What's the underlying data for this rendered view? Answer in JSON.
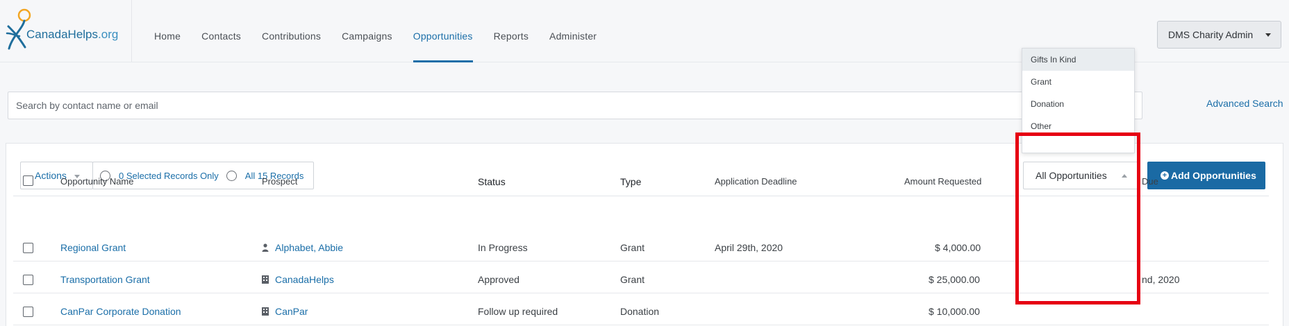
{
  "app": {
    "logo_name": "CanadaHelps",
    "logo_suffix": ".org"
  },
  "nav": {
    "items": [
      {
        "label": "Home",
        "active": false
      },
      {
        "label": "Contacts",
        "active": false
      },
      {
        "label": "Contributions",
        "active": false
      },
      {
        "label": "Campaigns",
        "active": false
      },
      {
        "label": "Opportunities",
        "active": true
      },
      {
        "label": "Reports",
        "active": false
      },
      {
        "label": "Administer",
        "active": false
      }
    ]
  },
  "user_menu": {
    "label": "DMS Charity Admin"
  },
  "search": {
    "placeholder": "Search by contact name or email",
    "value": "",
    "advanced_label": "Advanced Search"
  },
  "toolbar": {
    "actions_label": "Actions",
    "selected_label": "0 Selected Records Only",
    "all_label": "All 15 Records",
    "filter_label": "All Opportunities",
    "add_label": "Add Opportunities"
  },
  "filter_dropdown": {
    "options": [
      "Gifts In Kind",
      "Grant",
      "Donation",
      "Other"
    ],
    "hovered": "Gifts In Kind"
  },
  "table": {
    "headers": {
      "name": "Opportunity Name",
      "prospect": "Prospect",
      "status": "Status",
      "type": "Type",
      "deadline": "Application Deadline",
      "amount": "Amount Requested",
      "due_partial": "Due"
    },
    "rows": [
      {
        "name": "Regional Grant",
        "prospect": "Alphabet, Abbie",
        "prospect_icon": "person-icon",
        "status": "In Progress",
        "type": "Grant",
        "deadline": "April 29th, 2020",
        "amount": "$ 4,000.00",
        "due_partial": ""
      },
      {
        "name": "Transportation Grant",
        "prospect": "CanadaHelps",
        "prospect_icon": "building-icon",
        "status": "Approved",
        "type": "Grant",
        "deadline": "",
        "amount": "$ 25,000.00",
        "due_partial": "nd, 2020"
      },
      {
        "name": "CanPar Corporate Donation",
        "prospect": "CanPar",
        "prospect_icon": "building-icon",
        "status": "Follow up required",
        "type": "Donation",
        "deadline": "",
        "amount": "$ 10,000.00",
        "due_partial": ""
      }
    ]
  },
  "colors": {
    "accent": "#1a6ea8",
    "primary_button": "#1a6aa4",
    "highlight_box": "#e60012"
  }
}
